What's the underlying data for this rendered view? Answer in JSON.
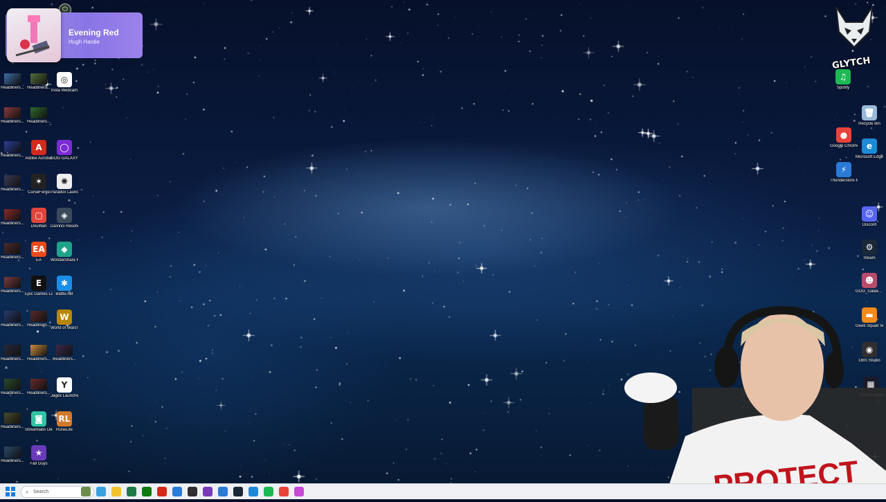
{
  "music_widget": {
    "title": "Evening Red",
    "artist": "Hugh Hardie",
    "power_icon": "power-icon"
  },
  "left_icons": [
    {
      "label": "Headliners...",
      "color": "#3b6ea5"
    },
    {
      "label": "Headliners...",
      "color": "#56703a"
    },
    {
      "label": "Insta Webcam",
      "color": "#ffffff",
      "glyph": "◎"
    },
    {
      "label": "Headliners...",
      "color": "#8a3a3a"
    },
    {
      "label": "Headliners...",
      "color": "#2e6a2a"
    },
    {
      "label": "Headliners...",
      "color": "#2a3f9a"
    },
    {
      "label": "Adobe Acrobat",
      "color": "#d42a1c",
      "glyph": "A"
    },
    {
      "label": "GOG GALAXY",
      "color": "#7b2bd6",
      "glyph": "◯"
    },
    {
      "label": "Headliners...",
      "color": "#3a3a55"
    },
    {
      "label": "CurseForge",
      "color": "#222222",
      "glyph": "✶"
    },
    {
      "label": "Paradox Launcher v2",
      "color": "#eeeeee",
      "glyph": "✺"
    },
    {
      "label": "Headliners...",
      "color": "#8a2a2a"
    },
    {
      "label": "DouWan",
      "color": "#e0453c",
      "glyph": "▢"
    },
    {
      "label": "DaVinci Resolve",
      "color": "#3a4a5a",
      "glyph": "◈"
    },
    {
      "label": "Headliners...",
      "color": "#4a2a2a"
    },
    {
      "label": "EA",
      "color": "#ea4a1a",
      "glyph": "EA"
    },
    {
      "label": "Wondershare Filmora 14",
      "color": "#1ea38a",
      "glyph": "◆"
    },
    {
      "label": "Headliners...",
      "color": "#7a3a3a"
    },
    {
      "label": "Epic Games Launcher",
      "color": "#111111",
      "glyph": "E"
    },
    {
      "label": "Battle.net",
      "color": "#1a8ee6",
      "glyph": "✱"
    },
    {
      "label": "Headliners...",
      "color": "#2a3a6a"
    },
    {
      "label": "Headliners...",
      "color": "#5a2a2a"
    },
    {
      "label": "World of Warcraft",
      "color": "#b8860b",
      "glyph": "W"
    },
    {
      "label": "Headliners...",
      "color": "#2a2a3a"
    },
    {
      "label": "Headliners...",
      "color": "#c98a3a"
    },
    {
      "label": "Headliners...",
      "color": "#3a2a4a"
    },
    {
      "label": "Headliners...",
      "color": "#2a4a2a"
    },
    {
      "label": "Headliners...",
      "color": "#6a2a2a"
    },
    {
      "label": "Jagex Launcher",
      "color": "#ffffff",
      "glyph": "Y"
    },
    {
      "label": "Headliners...",
      "color": "#4a4a2a"
    },
    {
      "label": "Streamlabs Desktop",
      "color": "#31c3a2",
      "glyph": "◙"
    },
    {
      "label": "RuneLite",
      "color": "#d07a2a",
      "glyph": "RL"
    },
    {
      "label": "Headliners...",
      "color": "#2a4a6a"
    },
    {
      "label": "Fall Guys",
      "color": "#6a3ab8",
      "glyph": "★"
    }
  ],
  "right_icons": [
    {
      "label": "Spotify",
      "color": "#1db954",
      "glyph": "♫"
    },
    {
      "label": "Recycle Bin",
      "color": "#9ab8d8",
      "glyph": "🗑"
    },
    {
      "label": "Google Chrome",
      "color": "#e8433a",
      "glyph": "●"
    },
    {
      "label": "Microsoft Edge",
      "color": "#1d8ad6",
      "glyph": "e"
    },
    {
      "label": "Thunderstore Mod Mana...",
      "color": "#2a7ad6",
      "glyph": "⚡"
    },
    {
      "label": "Discord",
      "color": "#5865f2",
      "glyph": "☺"
    },
    {
      "label": "Steam",
      "color": "#1b2838",
      "glyph": "⚙"
    },
    {
      "label": "GOG_Galax... - Shortcut",
      "color": "#b84a6a",
      "glyph": "☻"
    },
    {
      "label": "Geek Squad Support.exe",
      "color": "#f28a1c",
      "glyph": "▬"
    },
    {
      "label": "OBS Studio",
      "color": "#302e31",
      "glyph": "◉"
    },
    {
      "label": "Stream Deck",
      "color": "#1a1a2a",
      "glyph": "▦"
    }
  ],
  "overlay": {
    "brand": "GLYTCH"
  },
  "taskbar": {
    "search_placeholder": "Search",
    "apps": [
      {
        "name": "widgets-icon",
        "color": "#6b8e4e"
      },
      {
        "name": "copilot-icon",
        "color": "#3ba0e0"
      },
      {
        "name": "file-explorer-icon",
        "color": "#f2c230"
      },
      {
        "name": "excel-icon",
        "color": "#1f7a45"
      },
      {
        "name": "xbox-icon",
        "color": "#107c10"
      },
      {
        "name": "acrobat-icon",
        "color": "#d42a1c"
      },
      {
        "name": "store-icon",
        "color": "#2a7ad6"
      },
      {
        "name": "obs-icon",
        "color": "#302e31"
      },
      {
        "name": "gamepad-icon",
        "color": "#7a3ab8"
      },
      {
        "name": "thunderstore-icon",
        "color": "#2a7ad6"
      },
      {
        "name": "steam-icon",
        "color": "#1b2838"
      },
      {
        "name": "edge-icon",
        "color": "#1d8ad6"
      },
      {
        "name": "spotify-icon",
        "color": "#1db954"
      },
      {
        "name": "chrome-icon",
        "color": "#e8433a"
      },
      {
        "name": "streamlabs-icon",
        "color": "#c64ad6"
      }
    ]
  },
  "webcam_shirt_text": "PROTECT"
}
